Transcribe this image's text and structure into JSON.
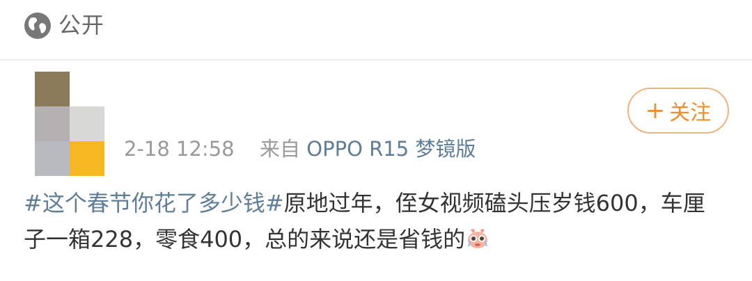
{
  "header": {
    "visibility_icon": "globe-icon",
    "visibility_label": "公开"
  },
  "post": {
    "avatar_colors": [
      "#8c7b5b",
      "#b5b1b2",
      "#d8d8d6",
      "#b9bac0",
      "#f5b823"
    ],
    "timestamp": "2-18 12:58",
    "source_prefix": "来自",
    "source": "OPPO R15 梦镜版",
    "follow_icon": "plus-icon",
    "follow_label": "关注",
    "topic": "#这个春节你花了多少钱#",
    "text": "原地过年，侄女视频磕头压岁钱600，车厘子一箱228，零食400，总的来说还是省钱的",
    "emoji": "crying-emoji-icon"
  },
  "colors": {
    "accent": "#f08c2b",
    "link": "#5d7d98",
    "meta": "#999999",
    "text": "#333333"
  }
}
